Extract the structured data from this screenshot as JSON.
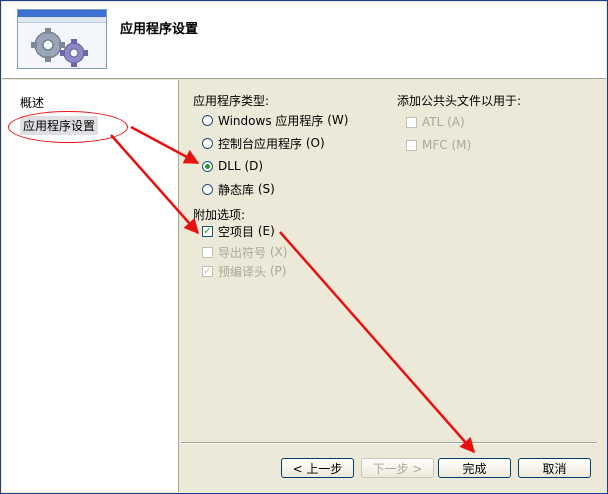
{
  "header": {
    "title": "应用程序设置"
  },
  "nav": {
    "overview": "概述",
    "app_settings": "应用程序设置"
  },
  "app_type": {
    "heading": "应用程序类型:",
    "options": [
      {
        "label": "Windows 应用程序",
        "key": "(W)",
        "selected": false
      },
      {
        "label": "控制台应用程序",
        "key": "(O)",
        "selected": false
      },
      {
        "label": "DLL",
        "key": "(D)",
        "selected": true
      },
      {
        "label": "静态库",
        "key": "(S)",
        "selected": false
      }
    ]
  },
  "extra_options": {
    "heading": "附加选项:",
    "empty_project": {
      "label": "空项目",
      "key": "(E)",
      "checked": true
    },
    "export_symbols": {
      "label": "导出符号",
      "key": "(X)",
      "checked": false,
      "enabled": false
    },
    "precompiled_header": {
      "label": "预编译头",
      "key": "(P)",
      "checked": true,
      "enabled": false
    }
  },
  "common_headers": {
    "heading": "添加公共头文件以用于:",
    "atl": {
      "label": "ATL",
      "key": "(A)",
      "enabled": false
    },
    "mfc": {
      "label": "MFC",
      "key": "(M)",
      "enabled": false
    }
  },
  "buttons": {
    "back": "< 上一步",
    "next": "下一步 >",
    "finish": "完成",
    "cancel": "取消"
  },
  "annotation_color": "#e81010",
  "icons": [
    "gear-icon",
    "wizard-banner-icon"
  ]
}
